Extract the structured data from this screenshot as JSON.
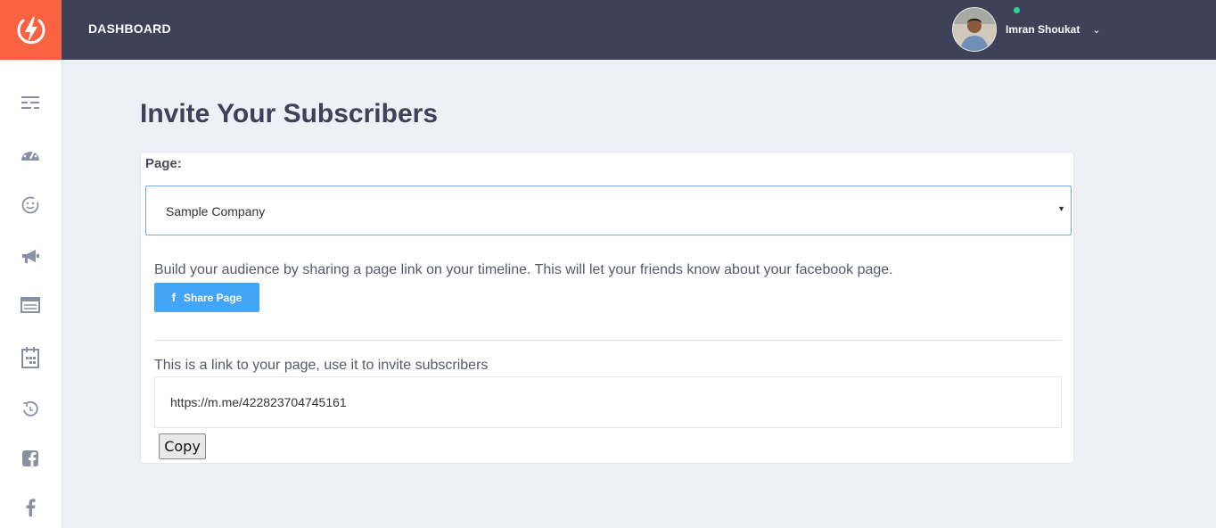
{
  "header": {
    "title": "DASHBOARD",
    "user_name": "Imran Shoukat",
    "logo_icon": "bolt-logo-icon",
    "online_color": "#2ed39a"
  },
  "theme": {
    "accent": "#fa6342",
    "topbar": "#3e4157",
    "button_blue": "#44a4f5"
  },
  "sidebar": {
    "items": [
      {
        "icon": "menu-list-icon"
      },
      {
        "icon": "dashboard-gauge-icon"
      },
      {
        "icon": "smiley-face-icon"
      },
      {
        "icon": "megaphone-icon"
      },
      {
        "icon": "window-list-icon"
      },
      {
        "icon": "calendar-icon"
      },
      {
        "icon": "history-icon"
      },
      {
        "icon": "facebook-square-icon"
      },
      {
        "icon": "facebook-f-icon"
      }
    ]
  },
  "main": {
    "title": "Invite Your Subscribers",
    "page_label": "Page:",
    "selected_page": "Sample Company",
    "share_description": "Build your audience by sharing a page link on your timeline. This will let your friends know about your facebook page.",
    "share_button": "Share Page",
    "link_label": "This is a link to your page, use it to invite subscribers",
    "link_value": "https://m.me/422823704745161",
    "copy_button": "Copy"
  }
}
